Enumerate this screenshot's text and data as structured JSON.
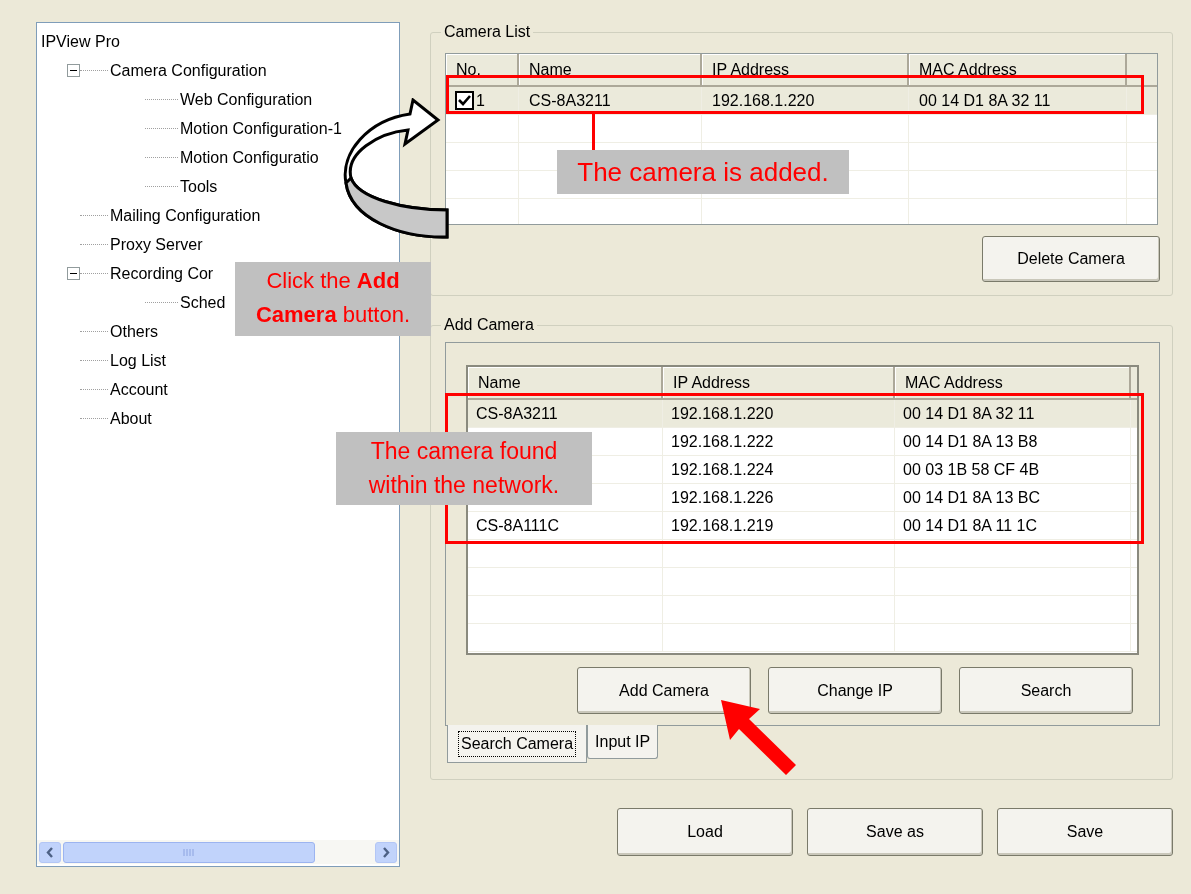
{
  "tree": {
    "label": "IPView Pro",
    "children": [
      {
        "label": "Camera Configuration",
        "expanded": true,
        "children": [
          {
            "label": "Web Configuration"
          },
          {
            "label": "Motion Configuration-1"
          },
          {
            "label": "Motion Configuratio"
          },
          {
            "label": "Tools"
          }
        ]
      },
      {
        "label": "Mailing Configuration"
      },
      {
        "label": "Proxy Server"
      },
      {
        "label": "Recording Cor",
        "expanded": true,
        "children": [
          {
            "label": "Sched"
          }
        ]
      },
      {
        "label": "Others"
      },
      {
        "label": "Log List"
      },
      {
        "label": "Account"
      },
      {
        "label": "About"
      }
    ]
  },
  "camera_list": {
    "title": "Camera List",
    "columns": [
      "No.",
      "Name",
      "IP Address",
      "MAC Address"
    ],
    "rows": [
      {
        "checked": true,
        "no": "1",
        "name": "CS-8A3211",
        "ip": "192.168.1.220",
        "mac": "00 14 D1 8A 32 11"
      }
    ],
    "button": "Delete Camera"
  },
  "add_camera": {
    "title": "Add Camera",
    "columns": [
      "Name",
      "IP Address",
      "MAC Address"
    ],
    "rows": [
      {
        "name": "CS-8A3211",
        "ip": "192.168.1.220",
        "mac": "00 14 D1 8A 32 11",
        "selected": true
      },
      {
        "ip": "192.168.1.222",
        "mac": "00 14 D1 8A 13 B8",
        "selected": false
      },
      {
        "ip": "192.168.1.224",
        "mac": "00 03 1B 58 CF 4B",
        "selected": false
      },
      {
        "ip": "192.168.1.226",
        "mac": "00 14 D1 8A 13 BC",
        "selected": false
      },
      {
        "name": "CS-8A111C",
        "ip": "192.168.1.219",
        "mac": "00 14 D1 8A 11 1C",
        "selected": false
      }
    ],
    "buttons": [
      "Add Camera",
      "Change IP",
      "Search"
    ],
    "tabs": [
      {
        "label": "Search Camera",
        "selected": true
      },
      {
        "label": "Input IP",
        "selected": false
      }
    ]
  },
  "footer_buttons": [
    "Load",
    "Save as",
    "Save"
  ],
  "annotations": [
    {
      "text": "The camera is added."
    },
    {
      "text": "Click the **Add Camera** button."
    },
    {
      "text": "The camera found within the network."
    }
  ]
}
